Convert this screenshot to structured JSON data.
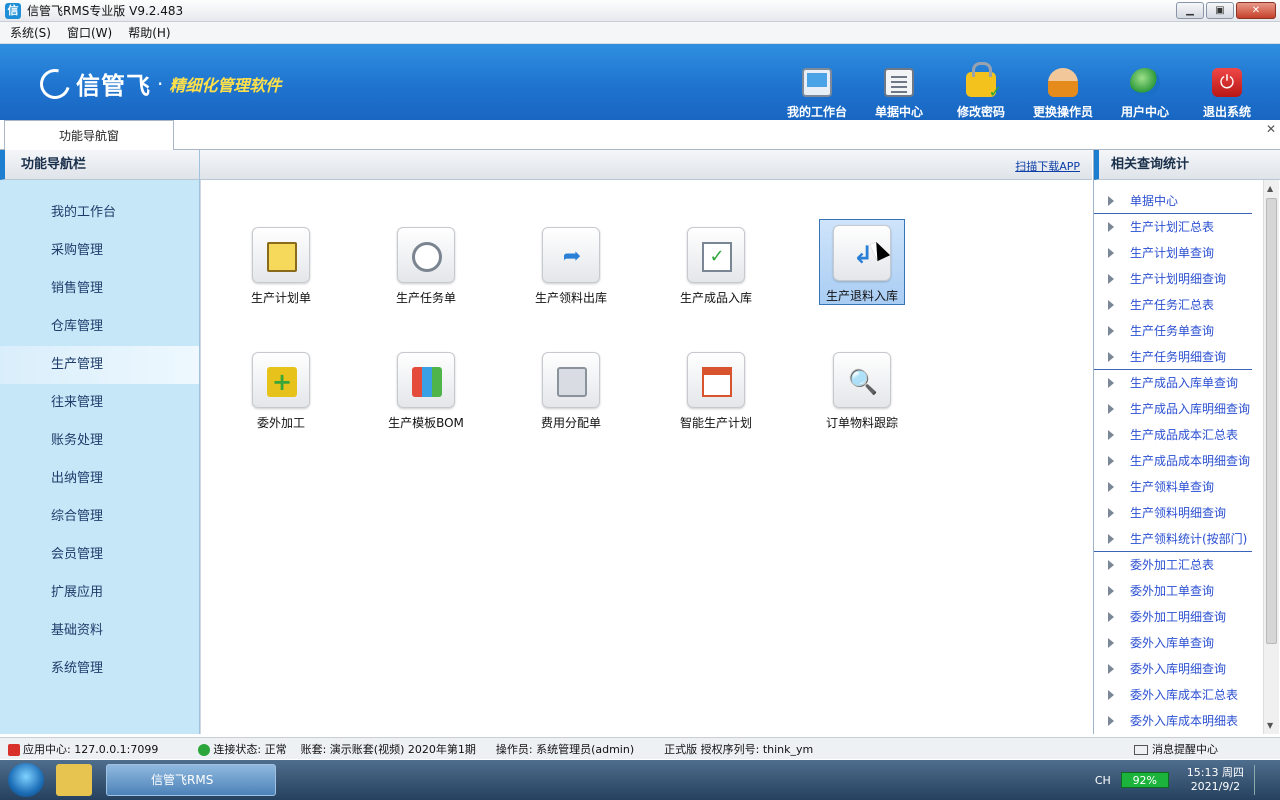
{
  "window": {
    "title": "信管飞RMS专业版 V9.2.483",
    "controls": {
      "minimize": "▁",
      "maximize": "▣",
      "close": "✕"
    }
  },
  "menu": [
    "系统(S)",
    "窗口(W)",
    "帮助(H)"
  ],
  "header": {
    "logo_text": "信管飞",
    "logo_dot": "·",
    "slogan": "精细化管理软件",
    "toolbar": [
      {
        "label": "我的工作台",
        "icon": "monitor-icon"
      },
      {
        "label": "单据中心",
        "icon": "document-list-icon"
      },
      {
        "label": "修改密码",
        "icon": "lock-icon"
      },
      {
        "label": "更换操作员",
        "icon": "person-icon"
      },
      {
        "label": "用户中心",
        "icon": "globe-icon"
      },
      {
        "label": "退出系统",
        "icon": "power-icon"
      }
    ]
  },
  "tabs": {
    "active": "功能导航窗",
    "close": "✕"
  },
  "left_nav": {
    "title": "功能导航栏",
    "items": [
      "我的工作台",
      "采购管理",
      "销售管理",
      "仓库管理",
      "生产管理",
      "往来管理",
      "账务处理",
      "出纳管理",
      "综合管理",
      "会员管理",
      "扩展应用",
      "基础资料",
      "系统管理"
    ],
    "active": "生产管理"
  },
  "main": {
    "qr_link": "扫描下载APP",
    "functions": [
      {
        "label": "生产计划单",
        "icon": "notepad-icon"
      },
      {
        "label": "生产任务单",
        "icon": "clock-doc-icon"
      },
      {
        "label": "生产领料出库",
        "icon": "arrow-doc-icon"
      },
      {
        "label": "生产成品入库",
        "icon": "check-doc-icon"
      },
      {
        "label": "生产退料入库",
        "icon": "return-doc-icon",
        "selected": true
      },
      {
        "label": "委外加工",
        "icon": "plus-box-icon"
      },
      {
        "label": "生产模板BOM",
        "icon": "bom-icon"
      },
      {
        "label": "费用分配单",
        "icon": "calculator-icon"
      },
      {
        "label": "智能生产计划",
        "icon": "calendar-icon"
      },
      {
        "label": "订单物料跟踪",
        "icon": "search-doc-icon"
      }
    ]
  },
  "right_panel": {
    "title": "相关查询统计",
    "items": [
      {
        "label": "单据中心",
        "sep": true
      },
      {
        "label": "生产计划汇总表"
      },
      {
        "label": "生产计划单查询"
      },
      {
        "label": "生产计划明细查询"
      },
      {
        "label": "生产任务汇总表"
      },
      {
        "label": "生产任务单查询"
      },
      {
        "label": "生产任务明细查询",
        "sep": true
      },
      {
        "label": "生产成品入库单查询"
      },
      {
        "label": "生产成品入库明细查询"
      },
      {
        "label": "生产成品成本汇总表"
      },
      {
        "label": "生产成品成本明细查询"
      },
      {
        "label": "生产领料单查询"
      },
      {
        "label": "生产领料明细查询"
      },
      {
        "label": "生产领料统计(按部门)",
        "sep": true
      },
      {
        "label": "委外加工汇总表"
      },
      {
        "label": "委外加工单查询"
      },
      {
        "label": "委外加工明细查询"
      },
      {
        "label": "委外入库单查询"
      },
      {
        "label": "委外入库明细查询"
      },
      {
        "label": "委外入库成本汇总表"
      },
      {
        "label": "委外入库成本明细表"
      }
    ],
    "scroll_up": "▲",
    "scroll_down": "▼"
  },
  "status": {
    "app_center": "应用中心: 127.0.0.1:7099",
    "connection": "连接状态: 正常",
    "account": "账套: 演示账套(视频) 2020年第1期",
    "operator": "操作员: 系统管理员(admin)",
    "license": "正式版 授权序列号: think_ym",
    "message_center": "消息提醒中心"
  },
  "taskbar": {
    "app": "信管飞RMS",
    "ime": "CH",
    "battery": "92%",
    "time": "15:13 周四",
    "date": "2021/9/2"
  }
}
